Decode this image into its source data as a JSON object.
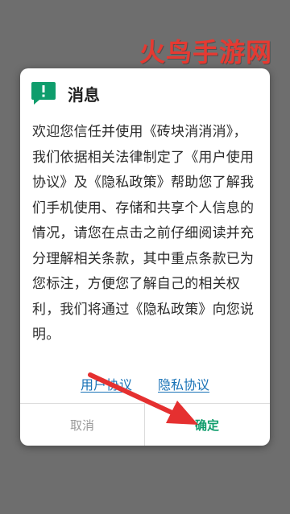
{
  "watermark": "火鸟手游网",
  "dialog": {
    "title": "消息",
    "icon": "message-alert-icon",
    "body": "欢迎您信任并使用《砖块消消消》，我们依据相关法律制定了《用户使用协议》及《隐私政策》帮助您了解我们手机使用、存储和共享个人信息的情况，请您在点击之前仔细阅读并充分理解相关条款，其中重点条款已为您标注，方便您了解自己的相关权利，我们将通过《隐私政策》向您说明。",
    "links": {
      "user_agreement": "用户协议",
      "privacy_agreement": "隐私协议"
    },
    "buttons": {
      "cancel": "取消",
      "confirm": "确定"
    }
  },
  "colors": {
    "accent": "#0f9d6c",
    "link": "#1a73b7",
    "watermark": "#e53a32",
    "arrow": "#e53030"
  }
}
